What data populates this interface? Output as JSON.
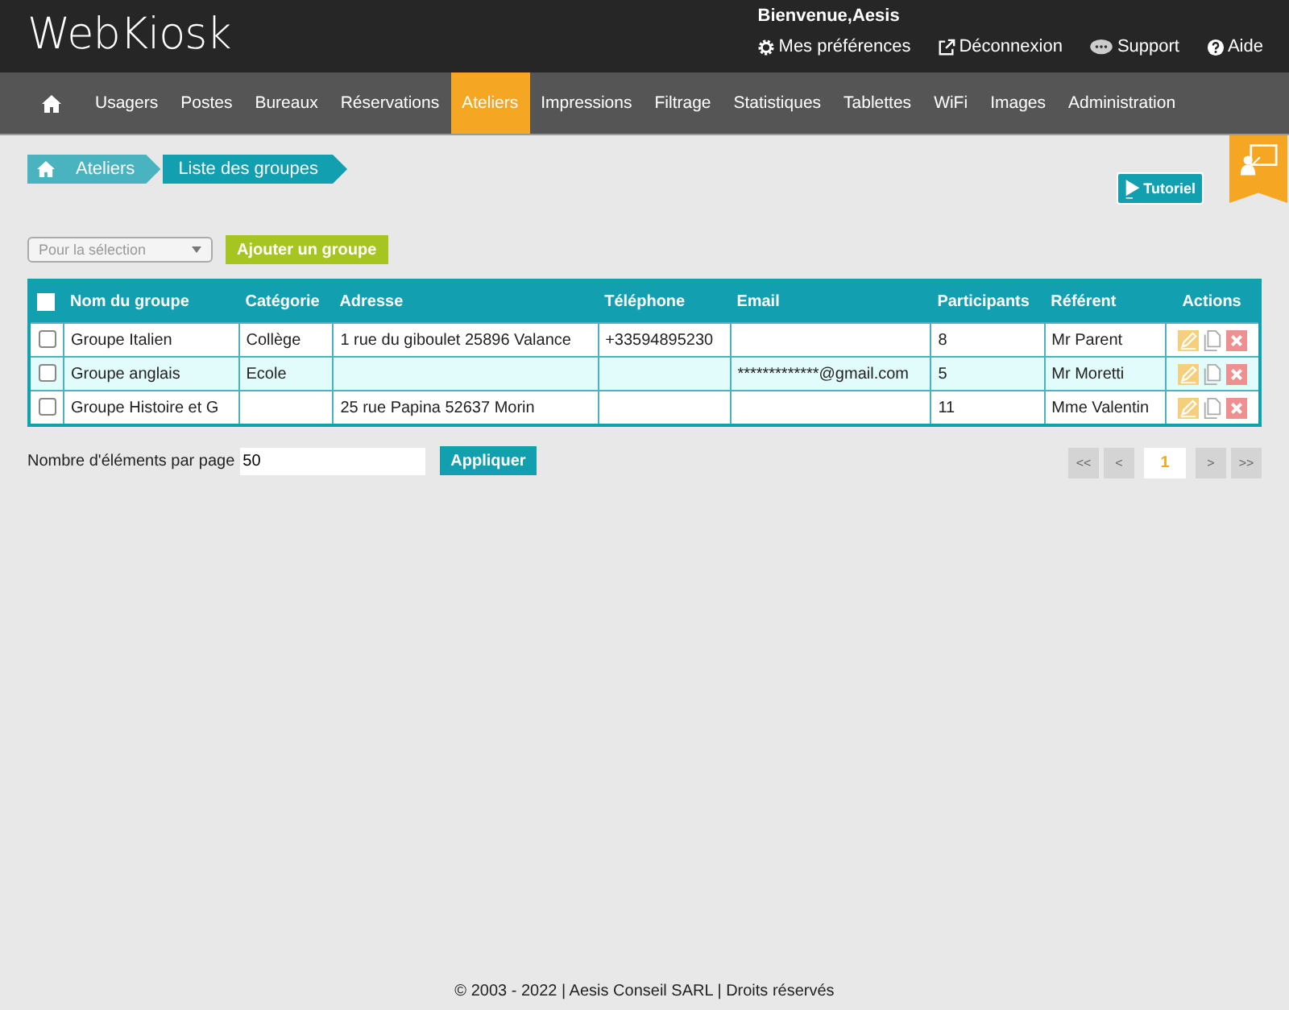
{
  "header": {
    "logo": "WebKiosk",
    "welcome": "Bienvenue,Aesis",
    "links": [
      {
        "kind": "gear",
        "label": "Mes préférences"
      },
      {
        "kind": "exit",
        "label": "Déconnexion"
      },
      {
        "kind": "chat",
        "label": "Support"
      },
      {
        "kind": "help",
        "label": "Aide"
      }
    ]
  },
  "nav": [
    {
      "label": "Usagers",
      "selected": false
    },
    {
      "label": "Postes",
      "selected": false
    },
    {
      "label": "Bureaux",
      "selected": false
    },
    {
      "label": "Réservations",
      "selected": false
    },
    {
      "label": "Ateliers",
      "selected": true
    },
    {
      "label": "Impressions",
      "selected": false
    },
    {
      "label": "Filtrage",
      "selected": false
    },
    {
      "label": "Statistiques",
      "selected": false
    },
    {
      "label": "Tablettes",
      "selected": false
    },
    {
      "label": "WiFi",
      "selected": false
    },
    {
      "label": "Images",
      "selected": false
    },
    {
      "label": "Administration",
      "selected": false
    }
  ],
  "breadcrumb": [
    "Ateliers",
    "Liste des groupes"
  ],
  "tutorial_button": "Tutoriel",
  "toolbar": {
    "select_placeholder": "Pour la sélection",
    "add_button": "Ajouter un groupe"
  },
  "table": {
    "columns": [
      "Nom du groupe",
      "Catégorie",
      "Adresse",
      "Téléphone",
      "Email",
      "Participants",
      "Référent",
      "Actions"
    ],
    "header_checked": false,
    "rows": [
      {
        "checked": false,
        "cells": [
          "Groupe Italien",
          "Collège",
          "1 rue du giboulet 25896 Valance",
          "+33594895230",
          "",
          "8",
          "Mr Parent"
        ]
      },
      {
        "checked": false,
        "cells": [
          "Groupe anglais",
          "Ecole",
          "",
          "",
          "*************@gmail.com",
          "5",
          "Mr Moretti"
        ]
      },
      {
        "checked": false,
        "cells": [
          "Groupe Histoire et G",
          "",
          "25 rue Papina 52637 Morin",
          "",
          "",
          "11",
          "Mme Valentin"
        ]
      }
    ]
  },
  "per_page": {
    "label": "Nombre d'éléments par page",
    "value": "50",
    "apply": "Appliquer"
  },
  "pagination": [
    {
      "label": "<<",
      "kind": "nav"
    },
    {
      "label": "<",
      "kind": "nav"
    },
    {
      "label": "1",
      "kind": "page",
      "selected": true
    },
    {
      "label": ">",
      "kind": "nav"
    },
    {
      "label": ">>",
      "kind": "nav"
    }
  ],
  "footer": "© 2003 - 2022 | Aesis Conseil SARL | Droits réservés"
}
